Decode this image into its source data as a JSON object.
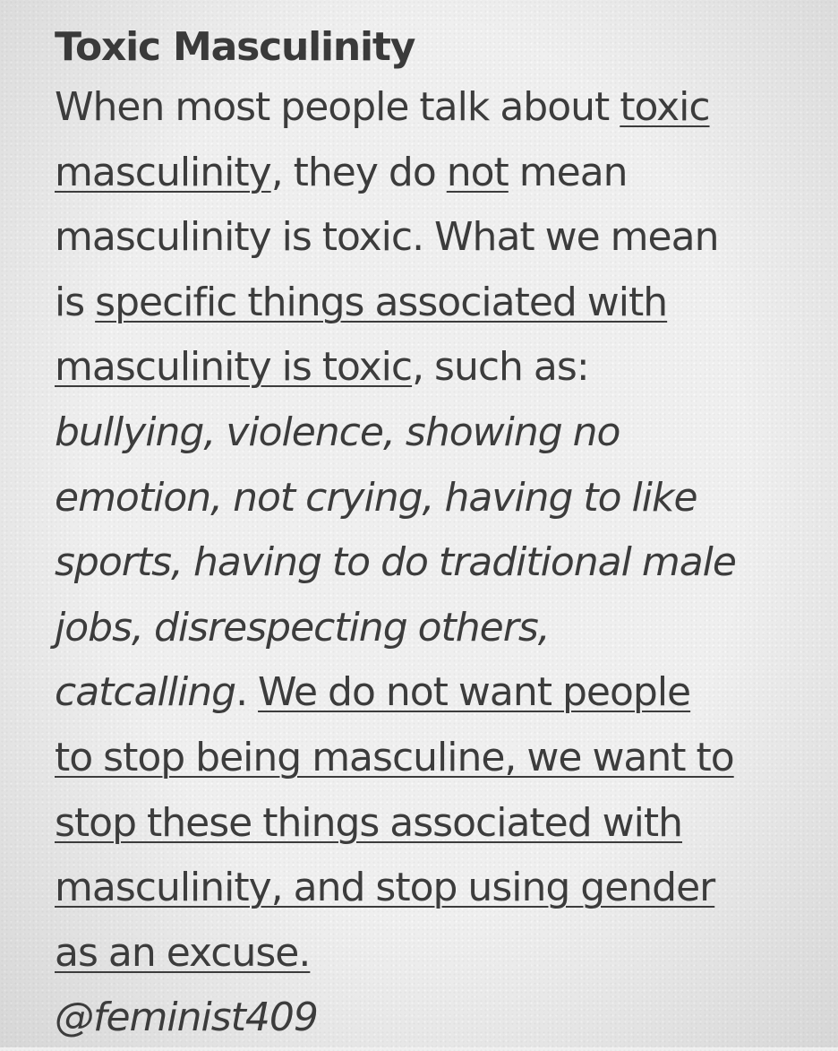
{
  "note": {
    "title": "Toxic Masculinity",
    "body": {
      "t01": "When most people talk about ",
      "u01": "toxic",
      "u02": "masculinity",
      "t02": ", they do ",
      "u03": "not",
      "t03": " mean",
      "t04": "masculinity is toxic. What we mean",
      "t05": "is ",
      "u04": "specific things associated with",
      "u05": "masculinity is toxic",
      "t06": ", such as:",
      "i01": "bullying, violence, showing no",
      "i02": "emotion, not crying, having to like",
      "i03": "sports, having to do traditional male",
      "i04": "jobs, disrespecting others,",
      "i05": "catcalling",
      "t07": ". ",
      "u06": "We do not want people",
      "u07": "to stop being masculine, we want to",
      "u08": "stop these things associated with",
      "u09": "masculinity, and stop using gender",
      "u10": "as an excuse.",
      "i06": "@feminist409"
    }
  }
}
